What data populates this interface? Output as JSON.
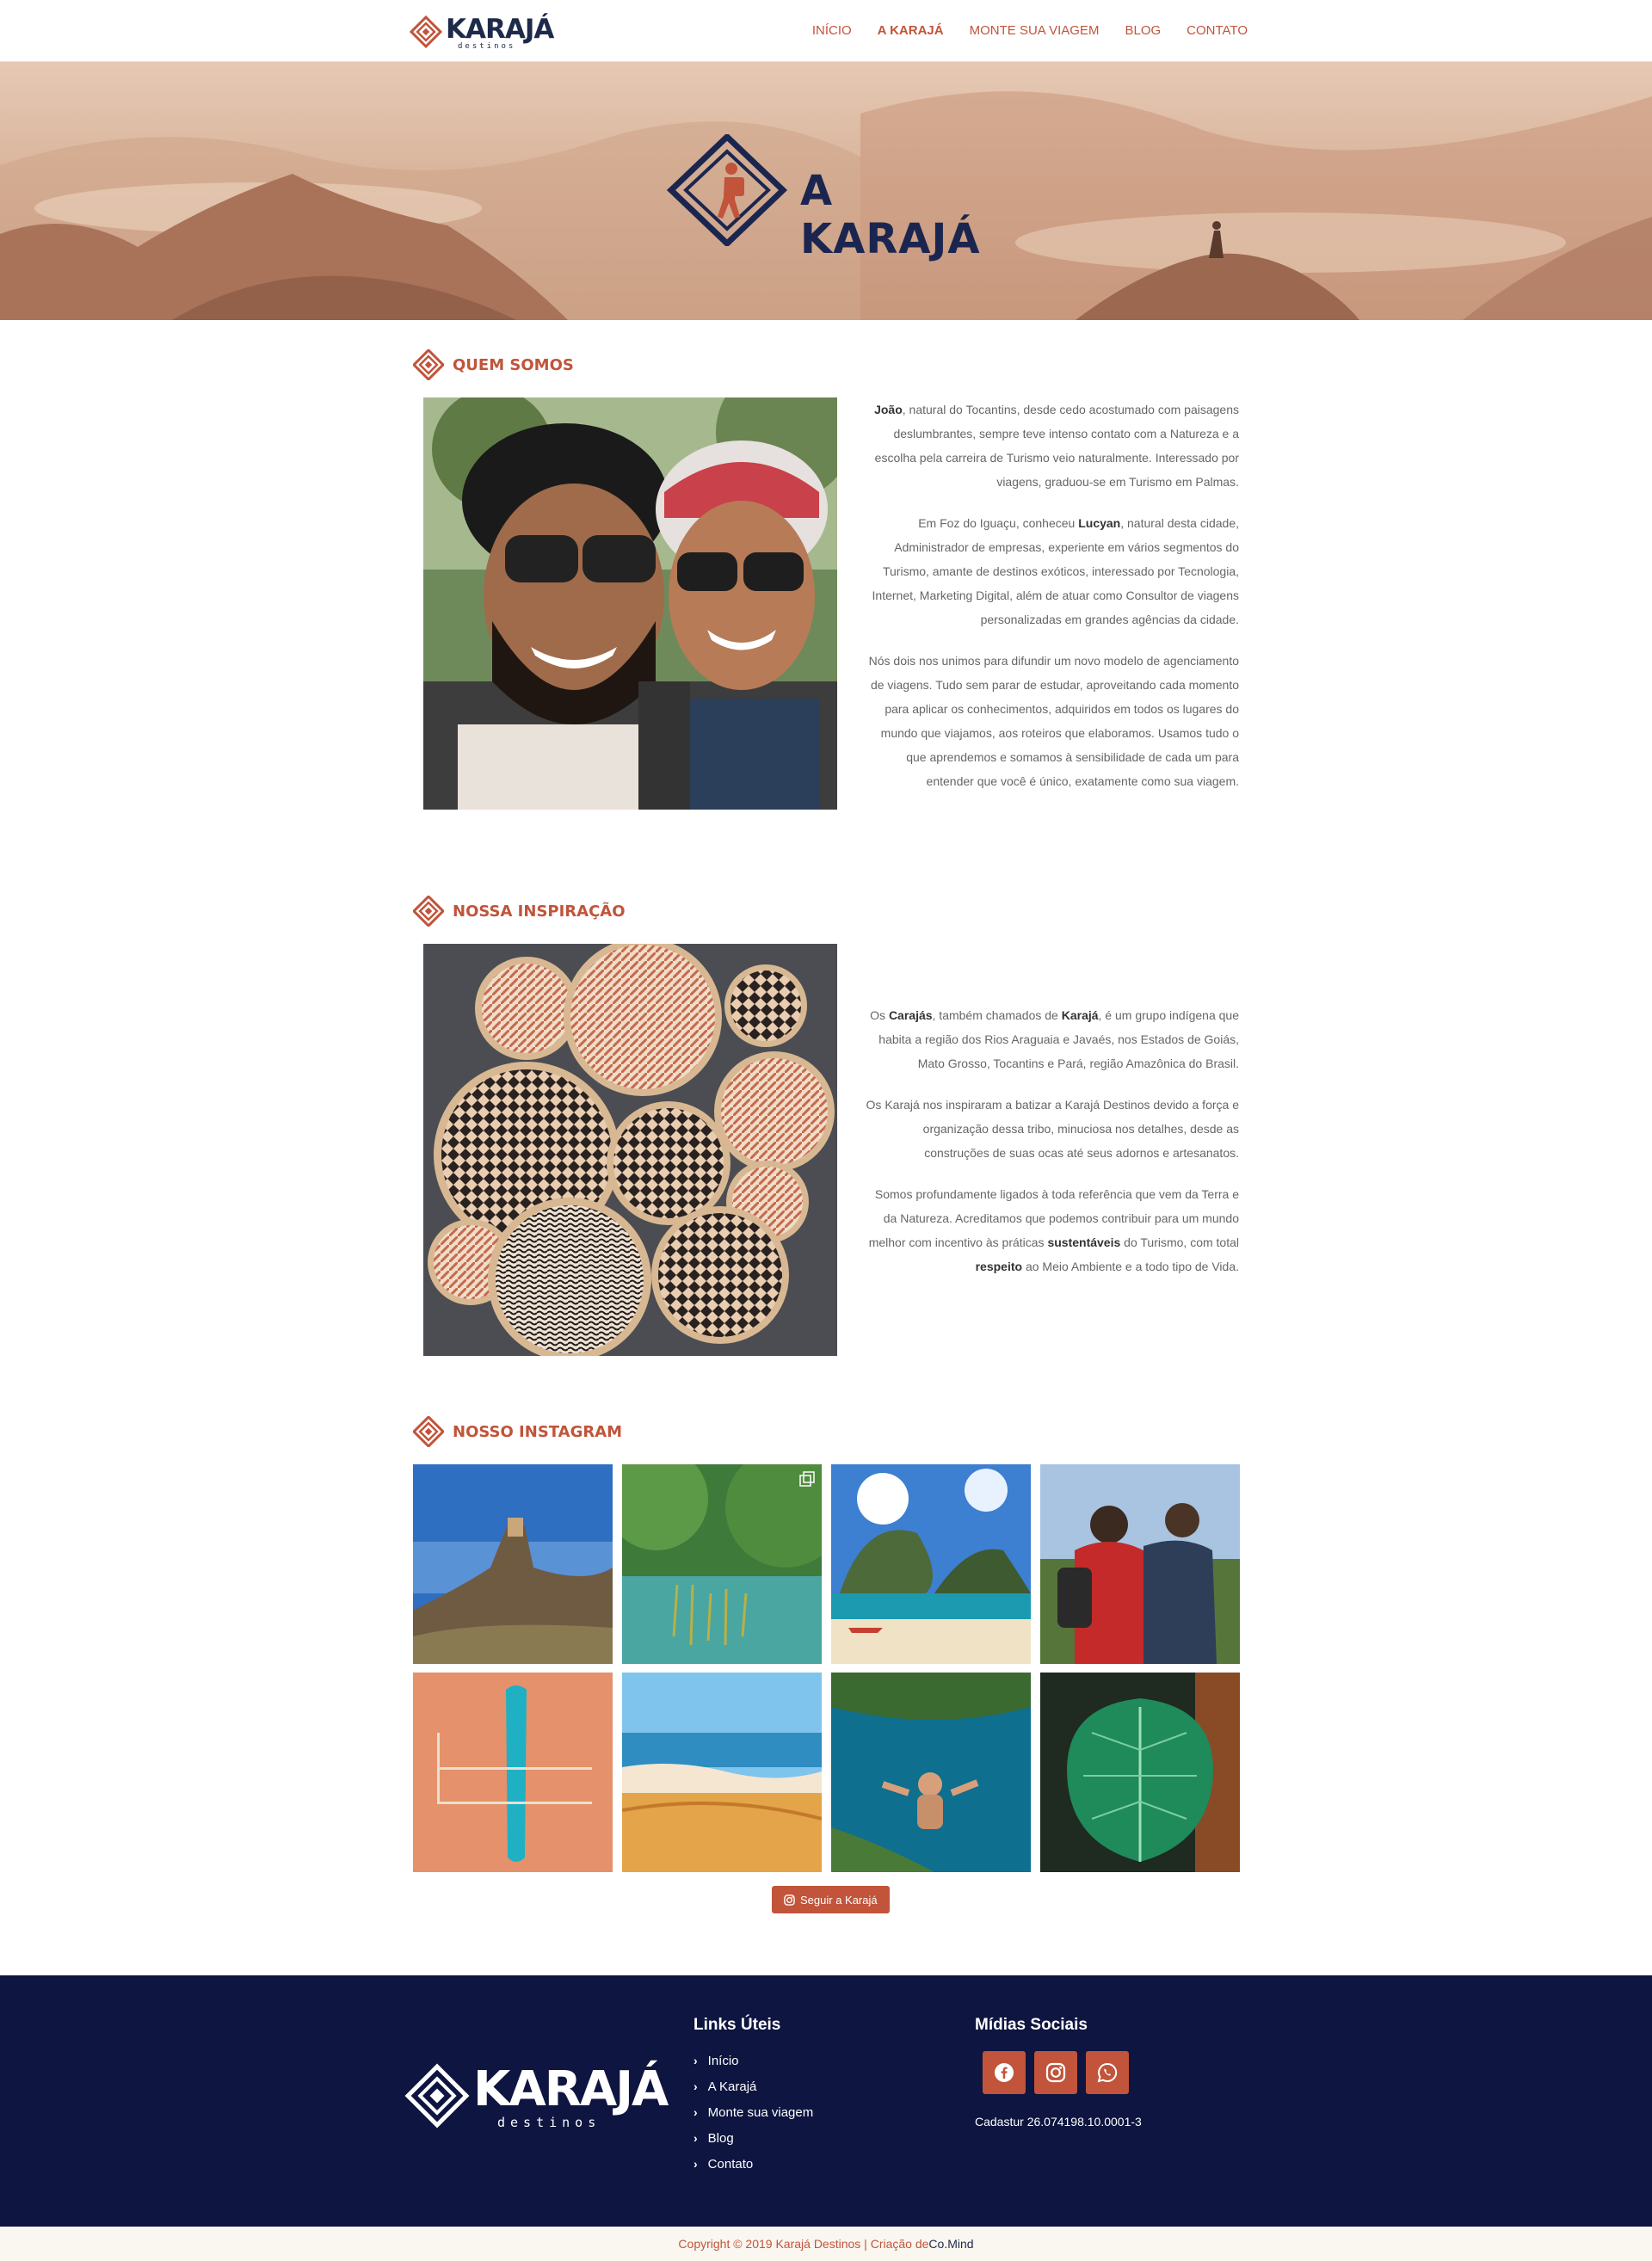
{
  "header": {
    "logo_word": "KARAJÁ",
    "logo_sub": "destinos",
    "nav": [
      {
        "label": "INÍCIO"
      },
      {
        "label": "A KARAJÁ"
      },
      {
        "label": "MONTE SUA VIAGEM"
      },
      {
        "label": "BLOG"
      },
      {
        "label": "CONTATO"
      }
    ],
    "active_index": 1
  },
  "hero": {
    "title": "A KARAJÁ"
  },
  "quem_somos": {
    "title": "QUEM SOMOS",
    "p1_name": "João",
    "p1_text": ", natural do Tocantins, desde cedo acostumado com paisagens deslumbrantes, sempre teve intenso contato com a Natureza e a escolha pela carreira de Turismo veio naturalmente. Interessado por viagens, graduou-se em Turismo em Palmas.",
    "p2_pre": "Em Foz do Iguaçu, conheceu ",
    "p2_name": "Lucyan",
    "p2_text": ", natural desta cidade, Administrador de empresas, experiente em vários segmentos do Turismo, amante de destinos exóticos, interessado por Tecnologia, Internet, Marketing Digital, além de atuar como Consultor de viagens personalizadas em grandes agências da cidade.",
    "p3_text": "Nós dois nos unimos para difundir um novo modelo de agenciamento de viagens. Tudo sem parar de estudar, aproveitando cada momento para aplicar os conhecimentos, adquiridos em todos os lugares do mundo que viajamos, aos roteiros que elaboramos. Usamos tudo o que aprendemos e somamos à sensibilidade de cada um para entender que você é único, exatamente como sua viagem."
  },
  "inspiracao": {
    "title": "NOSSA INSPIRAÇÃO",
    "p1_pre": "Os ",
    "p1_b1": "Carajás",
    "p1_mid": ", também chamados de ",
    "p1_b2": "Karajá",
    "p1_text": ", é um grupo indígena que habita a região dos Rios Araguaia e Javaés, nos Estados de Goiás, Mato Grosso, Tocantins e Pará, região Amazônica do Brasil.",
    "p2_text": "Os Karajá nos inspiraram a batizar a Karajá Destinos devido a força e organização dessa tribo, minuciosa nos detalhes, desde as construções de suas ocas até seus adornos e artesanatos.",
    "p3_pre": "Somos profundamente ligados à toda referência que vem da Terra e da Natureza.  Acreditamos que podemos contribuir para um mundo melhor com incentivo às práticas ",
    "p3_b1": "sustentáveis",
    "p3_mid": " do Turismo, com total ",
    "p3_b2": "respeito",
    "p3_text": " ao Meio Ambiente e a todo tipo de Vida."
  },
  "instagram": {
    "title": "NOSSO INSTAGRAM",
    "follow_label": "Seguir a Karajá"
  },
  "footer": {
    "logo_word": "KARAJÁ",
    "logo_sub": "destinos",
    "links_title": "Links Úteis",
    "links": [
      {
        "label": "Início"
      },
      {
        "label": "A Karajá"
      },
      {
        "label": "Monte sua viagem"
      },
      {
        "label": "Blog"
      },
      {
        "label": "Contato"
      }
    ],
    "social_title": "Mídias Sociais",
    "social_icons": [
      "facebook-icon",
      "instagram-icon",
      "whatsapp-icon"
    ],
    "cadastur": "Cadastur 26.074198.10.0001-3",
    "copyright_pre": "Copyright © 2019 Karajá Destinos | Criação de ",
    "copyright_link": "Co.Mind"
  },
  "colors": {
    "accent": "#c1543a",
    "navy": "#0d1540",
    "logo_navy": "#1e2a4a"
  }
}
